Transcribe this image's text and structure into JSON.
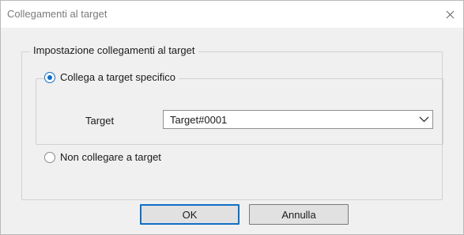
{
  "dialog": {
    "title": "Collegamenti al target",
    "close_icon": "close-icon"
  },
  "group": {
    "legend": "Impostazione collegamenti al target",
    "option_specific": {
      "label": "Collega a target specifico",
      "checked": true
    },
    "target_field": {
      "label": "Target",
      "value": "Target#0001",
      "icon": "chevron-down-icon"
    },
    "option_none": {
      "label": "Non collegare a target",
      "checked": false
    }
  },
  "buttons": {
    "ok": "OK",
    "cancel": "Annulla"
  },
  "colors": {
    "accent": "#0f6fc6",
    "background": "#f0f0f0"
  }
}
